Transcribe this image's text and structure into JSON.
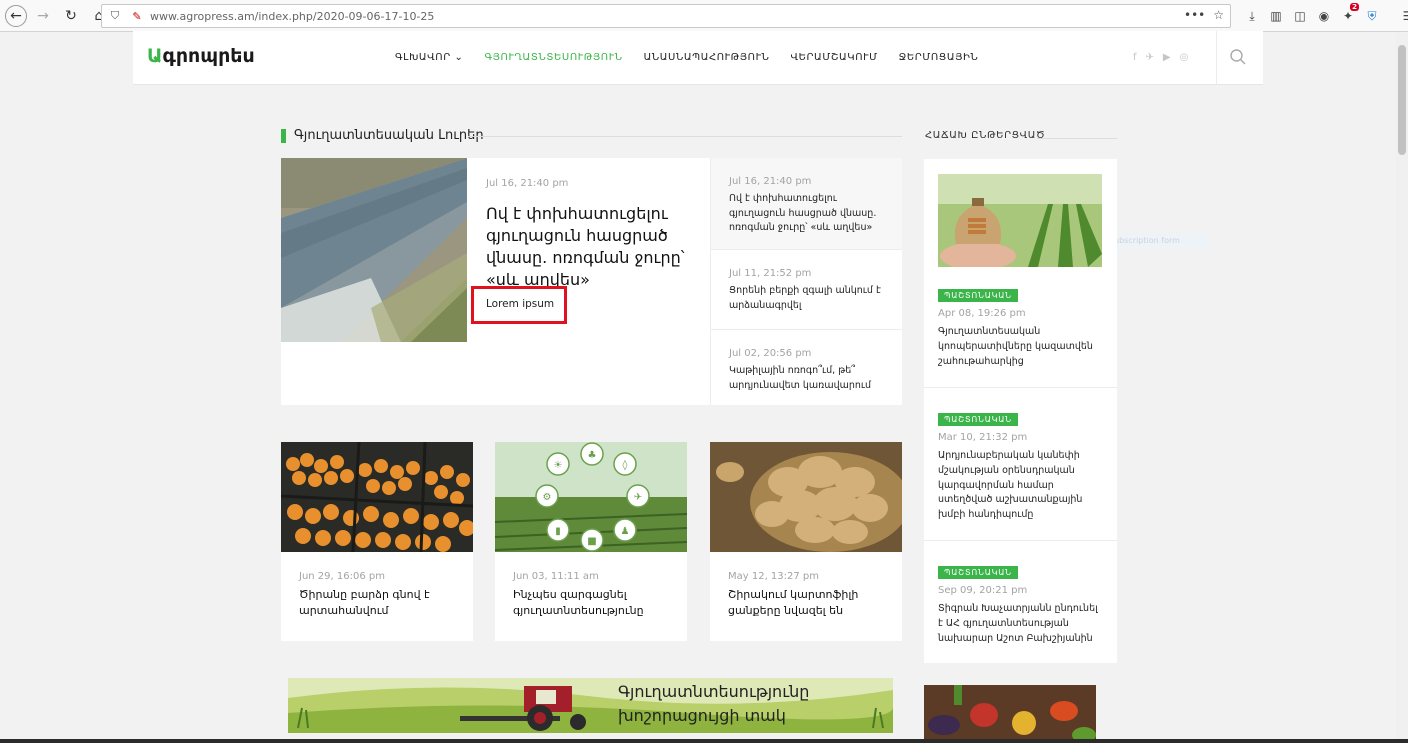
{
  "browser": {
    "url": "www.agropress.am/index.php/2020-09-06-17-10-25",
    "notification_count": "2"
  },
  "site": {
    "logo_first": "Ա",
    "logo_rest": "գրոպրես",
    "menu": [
      {
        "label": "ԳԼԽԱՎՈՐ"
      },
      {
        "label": "ԳՅՈՒՂԱՏՆՏԵՍՈՒԹՅՈՒՆ"
      },
      {
        "label": "ԱՆԱՍՆԱՊԱՀՈՒԹՅՈՒՆ"
      },
      {
        "label": "ՎԵՐԱՄՇԱԿՈՒՄ"
      },
      {
        "label": "ՋԵՐՄՈՑԱՅԻՆ"
      }
    ],
    "colors": {
      "accent": "#3bb54a",
      "highlight": "#e0121e"
    }
  },
  "section": {
    "title": "Գյուղատնտեսական Լուրեր"
  },
  "feature": {
    "date": "Jul 16, 21:40 pm",
    "title": "Ով է փոխհատուցելու գյուղացուն հասցրած վնասը. ոռոգման ջուրը՝ «սև աղվես»",
    "lorem": "Lorem ipsum"
  },
  "side_list": [
    {
      "date": "Jul 16, 21:40 pm",
      "title": "Ով է փոխհատուցելու գյուղացուն հասցրած վնասը. ոռոգման ջուրը՝ «սև աղվես»"
    },
    {
      "date": "Jul 11, 21:52 pm",
      "title": "Ցորենի բերքի զգալի անկում է արձանագրվել"
    },
    {
      "date": "Jul 02, 20:56 pm",
      "title": "Կաթիլային ոռոգո՞ւմ, թե՞ արդյունավետ կառավարում"
    }
  ],
  "cards": [
    {
      "date": "Jun 29, 16:06 pm",
      "title": "Ծիրանը բարձր գնով է արտահանվում"
    },
    {
      "date": "Jun 03, 11:11 am",
      "title": "Ինչպես զարգացնել գյուղատնտեսությունը"
    },
    {
      "date": "May 12, 13:27 pm",
      "title": "Շիրակում կարտոֆիլի ցանքերը նվազել են"
    }
  ],
  "banner": {
    "line1": "Գյուղատնտեսությունը",
    "line2": "խոշորացույցի տակ"
  },
  "sidebar": {
    "title": "ՀԱՃԱԽ ԸՆԹԵՐՑՎԱԾ",
    "ghost": "Subscription form",
    "items": [
      {
        "tag": "ՊԱՇՏՈՆԱԿԱՆ",
        "date": "Apr 08, 19:26 pm",
        "text": "Գյուղատնտեսական կոոպերատիվները կազատվեն շահութահարկից"
      },
      {
        "tag": "ՊԱՇՏՈՆԱԿԱՆ",
        "date": "Mar 10, 21:32 pm",
        "text": "Արդյունաբերական կանեփի մշակության օրենսդրական կարգավորման համար ստեղծված աշխատանքային խմբի հանդիպումը"
      },
      {
        "tag": "ՊԱՇՏՈՆԱԿԱՆ",
        "date": "Sep 09, 20:21 pm",
        "text": "Տիգրան Խաչատրյանն ընդունել է ԱՀ գյուղատնտեսության նախարար Աշոտ Բախշիյանին"
      }
    ]
  }
}
